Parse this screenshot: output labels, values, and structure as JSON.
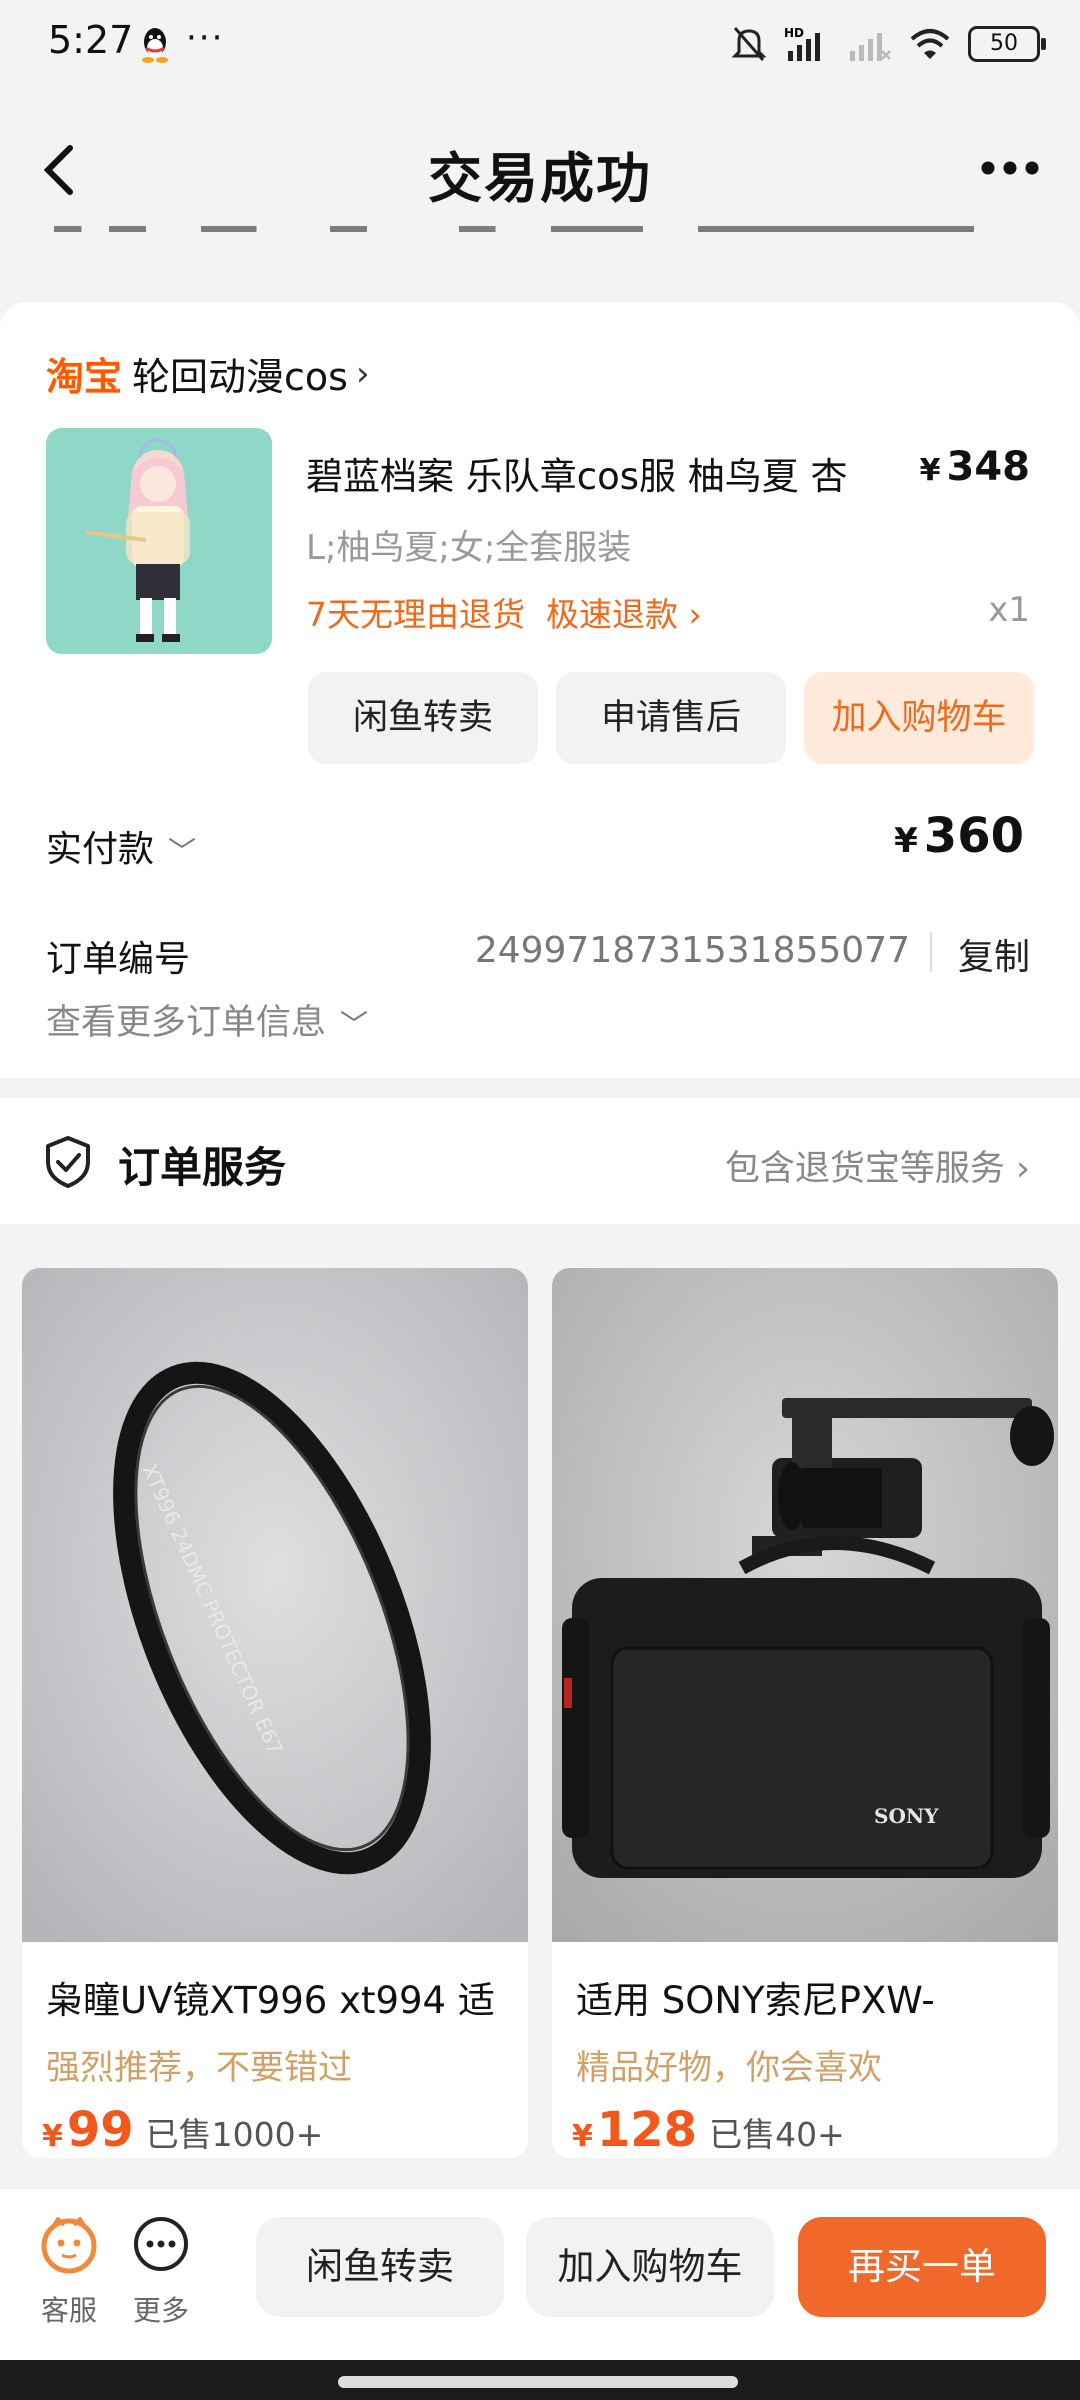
{
  "status_bar": {
    "time": "5:27",
    "battery": "50"
  },
  "nav": {
    "title": "交易成功",
    "back_icon": "chevron-left-icon",
    "more_icon": "more-dots-icon"
  },
  "order": {
    "shop_platform": "淘宝",
    "shop_name": "轮回动漫cos",
    "item": {
      "title": "碧蓝档案 乐队章cos服 柚鸟夏 杏",
      "price_symbol": "¥",
      "price": "348",
      "sku": "L;柚鸟夏;女;全套服装",
      "return_policy": "7天无理由退货  极速退款",
      "quantity": "x1"
    },
    "actions": [
      "闲鱼转卖",
      "申请售后",
      "加入购物车"
    ],
    "paid_label": "实付款",
    "paid_symbol": "¥",
    "paid_amount": "360",
    "order_no_label": "订单编号",
    "order_no": "2499718731531855077",
    "copy_label": "复制",
    "more_info": "查看更多订单信息"
  },
  "service": {
    "title": "订单服务",
    "detail": "包含退货宝等服务"
  },
  "recommendations": [
    {
      "name": "枭瞳UV镜XT996 xt994 适",
      "tag": "强烈推荐，不要错过",
      "symbol": "¥",
      "price": "99",
      "sold": "已售1000+",
      "image_text": "XT996  24DMC PROTECTOR E67"
    },
    {
      "name": "适用 SONY索尼PXW-",
      "tag": "精品好物，你会喜欢",
      "symbol": "¥",
      "price": "128",
      "sold": "已售40+",
      "image_text": "SONY"
    }
  ],
  "bottom_bar": {
    "service_label": "客服",
    "more_label": "更多",
    "resell": "闲鱼转卖",
    "add_cart": "加入购物车",
    "buy_again": "再买一单"
  },
  "colors": {
    "accent": "#f0692a",
    "taobao": "#ff5a00",
    "tag": "#d1a066"
  }
}
